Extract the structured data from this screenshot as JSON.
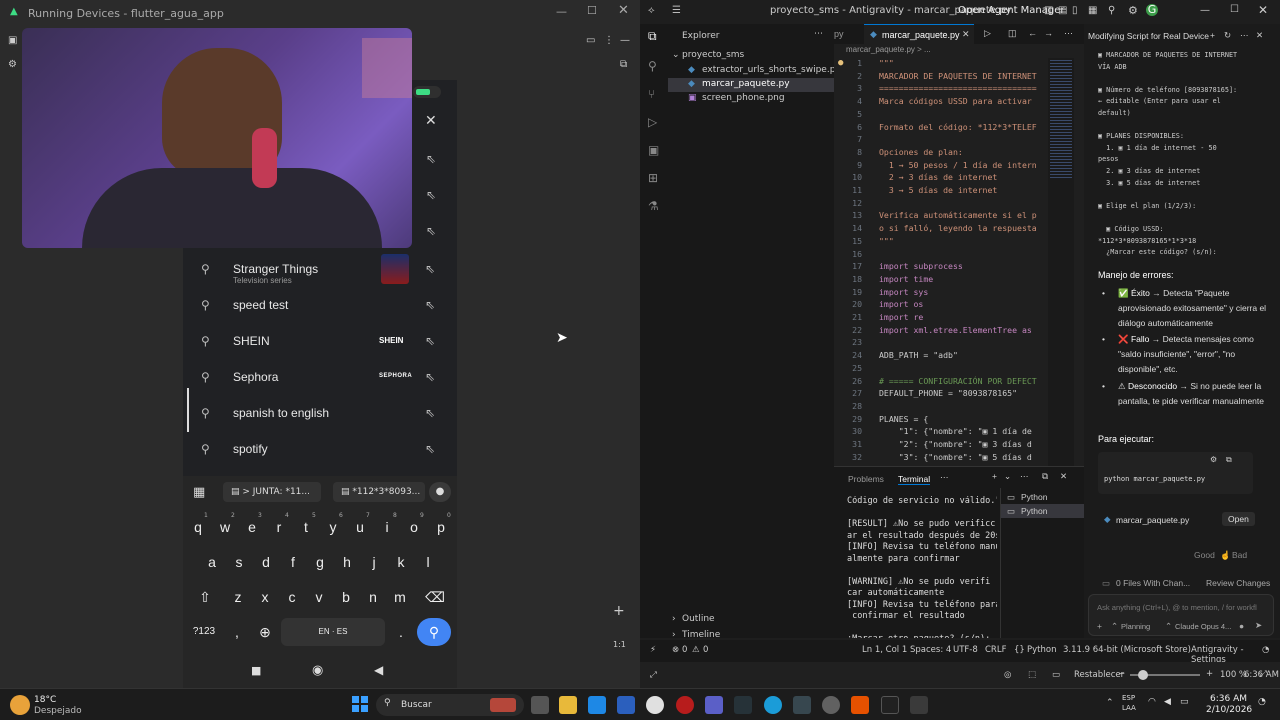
{
  "left_window": {
    "title": "Running Devices - flutter_agua_app",
    "suggestions": [
      {
        "label": "Stranger Things",
        "sub": "Television series",
        "thumb": "stranger-things-thumbnail"
      },
      {
        "label": "speed test",
        "sub": "",
        "thumb": ""
      },
      {
        "label": "SHEIN",
        "sub": "",
        "thumb": "SHEIN"
      },
      {
        "label": "Sephora",
        "sub": "",
        "thumb": "SEPHORA"
      },
      {
        "label": "spanish to english",
        "sub": "",
        "thumb": ""
      },
      {
        "label": "spotify",
        "sub": "",
        "thumb": ""
      }
    ],
    "clipboard1": "> JUNTA: *11...",
    "clipboard2": "*112*3*8093...",
    "keyboard": {
      "row1": [
        "q",
        "w",
        "e",
        "r",
        "t",
        "y",
        "u",
        "i",
        "o",
        "p"
      ],
      "row1_hints": [
        "1",
        "2",
        "3",
        "4",
        "5",
        "6",
        "7",
        "8",
        "9",
        "0"
      ],
      "row2": [
        "a",
        "s",
        "d",
        "f",
        "g",
        "h",
        "j",
        "k",
        "l"
      ],
      "row3": [
        "z",
        "x",
        "c",
        "v",
        "b",
        "n",
        "m"
      ],
      "sym_key": "?123",
      "comma": ",",
      "space": "EN · ES",
      "period": "."
    },
    "zoom_label": "1:1"
  },
  "right_window": {
    "title": "proyecto_sms - Antigravity - marcar_paquete.py",
    "agent_manager": "Open Agent Manager",
    "explorer_title": "Explorer",
    "project": "proyecto_sms",
    "files": [
      "extractor_urls_shorts_swipe.py",
      "marcar_paquete.py",
      "screen_phone.png"
    ],
    "outline": "Outline",
    "timeline": "Timeline",
    "tabs": [
      "py",
      "marcar_paquete.py"
    ],
    "breadcrumb": "marcar_paquete.py > ...",
    "code_lines": [
      {
        "n": "1",
        "t": "\"\"\""
      },
      {
        "n": "2",
        "t": "MARCADOR DE PAQUETES DE INTERNET"
      },
      {
        "n": "3",
        "t": "================================"
      },
      {
        "n": "4",
        "t": "Marca códigos USSD para activar"
      },
      {
        "n": "5",
        "t": ""
      },
      {
        "n": "6",
        "t": "Formato del código: *112*3*TELEF"
      },
      {
        "n": "7",
        "t": ""
      },
      {
        "n": "8",
        "t": "Opciones de plan:"
      },
      {
        "n": "9",
        "t": "  1 → 50 pesos / 1 día de intern"
      },
      {
        "n": "10",
        "t": "  2 → 3 días de internet"
      },
      {
        "n": "11",
        "t": "  3 → 5 días de internet"
      },
      {
        "n": "12",
        "t": ""
      },
      {
        "n": "13",
        "t": "Verifica automáticamente si el p"
      },
      {
        "n": "14",
        "t": "o si falló, leyendo la respuesta"
      },
      {
        "n": "15",
        "t": "\"\"\""
      },
      {
        "n": "16",
        "t": ""
      },
      {
        "n": "17",
        "t": "import subprocess"
      },
      {
        "n": "18",
        "t": "import time"
      },
      {
        "n": "19",
        "t": "import sys"
      },
      {
        "n": "20",
        "t": "import os"
      },
      {
        "n": "21",
        "t": "import re"
      },
      {
        "n": "22",
        "t": "import xml.etree.ElementTree as"
      },
      {
        "n": "23",
        "t": ""
      },
      {
        "n": "24",
        "t": "ADB_PATH = \"adb\""
      },
      {
        "n": "25",
        "t": ""
      },
      {
        "n": "26",
        "t": "# ===== CONFIGURACIÓN POR DEFECT"
      },
      {
        "n": "27",
        "t": "DEFAULT_PHONE = \"8093878165\""
      },
      {
        "n": "28",
        "t": ""
      },
      {
        "n": "29",
        "t": "PLANES = {"
      },
      {
        "n": "30",
        "t": "    \"1\": {\"nombre\": \"▣ 1 día de"
      },
      {
        "n": "31",
        "t": "    \"2\": {\"nombre\": \"▣ 3 días d"
      },
      {
        "n": "32",
        "t": "    \"3\": {\"nombre\": \"▣ 5 días d"
      }
    ],
    "panel_tabs": [
      "Problems",
      "Terminal"
    ],
    "terminal_lines": [
      "Código de servicio no válido.\"",
      "",
      "[RESULT] ⚠No se pudo verificc",
      "ar el resultado después de 20s",
      "[INFO] Revisa tu teléfono manu",
      "almente para confirmar",
      "",
      "[WARNING] ⚠No se pudo verifi",
      "car automáticamente",
      "[INFO] Revisa tu teléfono para",
      " confirmar el resultado",
      "",
      "¿Marcar otro paquete? (s/n):"
    ],
    "terminal_sessions": [
      "Python",
      "Python"
    ],
    "chat": {
      "title": "Modifying Script for Real Device",
      "preview_lines": [
        "▣ MARCADOR DE PAQUETES DE INTERNET",
        "VÍA ADB",
        "",
        "▣ Número de teléfono [8093878165]:",
        "← editable (Enter para usar el",
        "default)",
        "",
        "▣ PLANES DISPONIBLES:",
        "  1. ▣ 1 día de internet - 50",
        "pesos",
        "  2. ▣ 3 días de internet",
        "  3. ▣ 5 días de internet",
        "",
        "▣ Elige el plan (1/2/3):",
        "",
        "  ▣ Código USSD:",
        "*112*3*8093878165*1*3*18",
        "  ¿Marcar este código? (s/n):"
      ],
      "errors_heading": "Manejo de errores:",
      "bullets": [
        {
          "icon": "✅",
          "bold": "Éxito",
          "text": "→ Detecta \"Paquete aprovisionado exitosamente\" y cierra el diálogo automáticamente"
        },
        {
          "icon": "❌",
          "bold": "Fallo",
          "text": "→ Detecta mensajes como \"saldo insuficiente\", \"error\", \"no disponible\", etc."
        },
        {
          "icon": "⚠",
          "bold": "Desconocido",
          "text": "→ Si no puede leer la pantalla, te pide verificar manualmente"
        }
      ],
      "run_heading": "Para ejecutar:",
      "command": "python marcar_paquete.py",
      "file_chip": "marcar_paquete.py",
      "open_btn": "Open",
      "good": "Good",
      "bad": "Bad",
      "files_changed": "0 Files With Chan...",
      "review_changes": "Review Changes",
      "input_placeholder": "Ask anything (Ctrl+L), @ to mention, / for workfl",
      "planning": "Planning",
      "model": "Claude Opus 4..."
    },
    "status": {
      "errors": "0",
      "warnings": "0",
      "position": "Ln 1, Col 1",
      "spaces": "Spaces: 4",
      "encoding": "UTF-8",
      "eol": "CRLF",
      "language": "Python",
      "interpreter": "3.11.9 64-bit (Microsoft Store)",
      "settings": "Antigravity - Settings"
    },
    "zoom": {
      "reset": "Restablecer",
      "level": "100 %"
    }
  },
  "taskbar": {
    "weather_temp": "18°C",
    "weather_desc": "Despejado",
    "search": "Buscar",
    "lang1": "ESP",
    "lang2": "LAA",
    "time": "6:36 AM",
    "date": "2/10/2026",
    "clock_top": "6:36 AM"
  },
  "colors": {
    "accent": "#0078d4",
    "chrome_blue": "#4285f4",
    "status_bar": "#181818"
  }
}
